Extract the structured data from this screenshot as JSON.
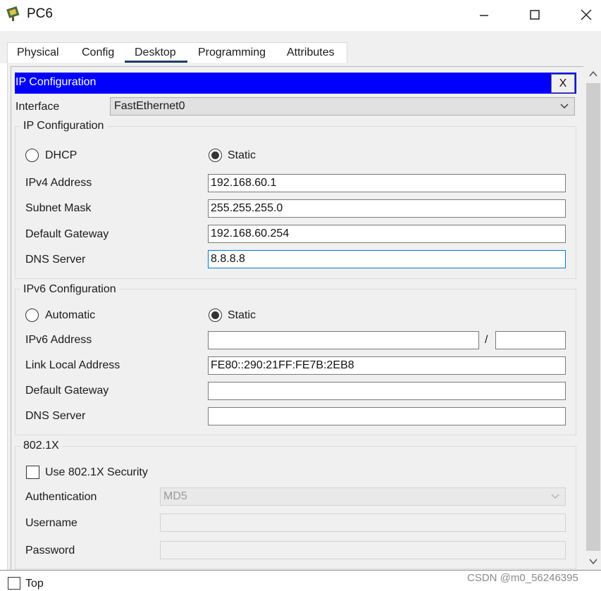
{
  "window": {
    "title": "PC6"
  },
  "tabs": [
    {
      "label": "Physical"
    },
    {
      "label": "Config"
    },
    {
      "label": "Desktop",
      "active": true
    },
    {
      "label": "Programming"
    },
    {
      "label": "Attributes"
    }
  ],
  "dialog": {
    "title": "IP Configuration",
    "close_label": "X"
  },
  "interface": {
    "label": "Interface",
    "value": "FastEthernet0"
  },
  "ipv4": {
    "group_title": "IP Configuration",
    "mode_options": [
      {
        "label": "DHCP",
        "selected": false
      },
      {
        "label": "Static",
        "selected": true
      }
    ],
    "address_label": "IPv4 Address",
    "address": "192.168.60.1",
    "mask_label": "Subnet Mask",
    "mask": "255.255.255.0",
    "gateway_label": "Default Gateway",
    "gateway": "192.168.60.254",
    "dns_label": "DNS Server",
    "dns": "8.8.8.8"
  },
  "ipv6": {
    "group_title": "IPv6 Configuration",
    "mode_options": [
      {
        "label": "Automatic",
        "selected": false
      },
      {
        "label": "Static",
        "selected": true
      }
    ],
    "address_label": "IPv6 Address",
    "address": "",
    "prefix_separator": "/",
    "prefix": "",
    "link_local_label": "Link Local Address",
    "link_local": "FE80::290:21FF:FE7B:2EB8",
    "gateway_label": "Default Gateway",
    "gateway": "",
    "dns_label": "DNS Server",
    "dns": ""
  },
  "dot1x": {
    "group_title": "802.1X",
    "use_security_label": "Use 802.1X Security",
    "authentication_label": "Authentication",
    "authentication": "MD5",
    "username_label": "Username",
    "username": "",
    "password_label": "Password",
    "password": ""
  },
  "footer": {
    "top_label": "Top",
    "watermark": "CSDN @m0_56246395"
  },
  "colors": {
    "header_blue": "#0000ff",
    "focus_blue": "#0078d7",
    "panel_bg": "#f0f0f0"
  }
}
